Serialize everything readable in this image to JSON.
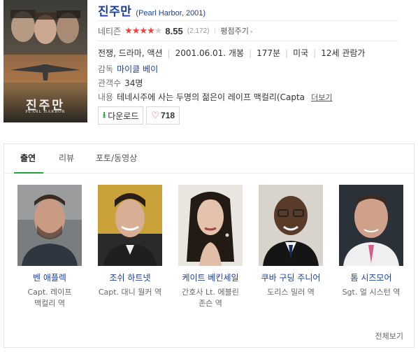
{
  "movie": {
    "title": "진주만",
    "subtitle": "(Pearl Harbor, 2001)",
    "poster_title": "진주만",
    "poster_subtitle": "PEARL HARBOR"
  },
  "rating": {
    "label": "네티즌",
    "stars_filled": 4,
    "stars_total": 5,
    "score": "8.55",
    "votes": "(2,172)",
    "rate_label": "평점주기",
    "star_color": "#f2413a"
  },
  "meta": {
    "genre": "전쟁, 드라마, 액션",
    "release": "2001.06.01. 개봉",
    "runtime": "177분",
    "country": "미국",
    "age": "12세 관람가",
    "director_label": "감독",
    "director": "마이클 베이",
    "audience_label": "관객수",
    "audience": "34명",
    "summary_label": "내용",
    "summary": "테네시주에 사는 두명의 젊은이 레이프 맥컬리(Captain Rafe Mc...",
    "more_label": "더보기"
  },
  "actions": {
    "download_label": "다운로드",
    "like_count": "718"
  },
  "tabs": [
    {
      "label": "출연",
      "active": true
    },
    {
      "label": "리뷰",
      "active": false
    },
    {
      "label": "포토/동영상",
      "active": false
    }
  ],
  "cast": [
    {
      "name": "벤 애플렉",
      "role": "Capt. 레이프 맥컬리 역"
    },
    {
      "name": "조쉬 하트넷",
      "role": "Capt. 대니 월커 역"
    },
    {
      "name": "케이트 베킨세일",
      "role": "간호사 Lt. 에블린 존슨 역"
    },
    {
      "name": "쿠바 구딩 주니어",
      "role": "도리스 밀러 역"
    },
    {
      "name": "톰 시즈모어",
      "role": "Sgt. 얼 시스턴 역"
    }
  ],
  "see_all_label": "전체보기",
  "colors": {
    "title_blue": "#1a3ea0",
    "accent_green": "#1ca33a",
    "heart_red": "#f0473f"
  }
}
